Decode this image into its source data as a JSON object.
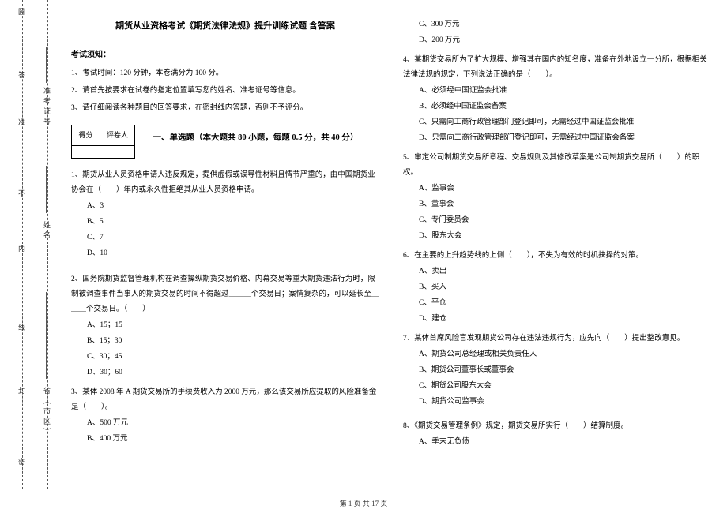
{
  "binding": {
    "outer_labels": [
      "姓名",
      "省（市区）"
    ],
    "inner_labels": [
      "准考证号"
    ],
    "spine_chars": [
      "圆",
      "答",
      "准",
      "不",
      "内",
      "线",
      "封",
      "密"
    ]
  },
  "title": "期货从业资格考试《期货法律法规》提升训练试题 含答案",
  "notice_head": "考试须知：",
  "notices": [
    "1、考试时间：120 分钟，本卷满分为 100 分。",
    "2、请首先按要求在试卷的指定位置填写您的姓名、准考证号等信息。",
    "3、请仔细阅读各种题目的回答要求，在密封线内答题，否则不予评分。"
  ],
  "score_cells": {
    "c1": "得分",
    "c2": "评卷人"
  },
  "section1": "一、单选题（本大题共 80 小题，每题 0.5 分，共 40 分）",
  "q1": {
    "stem": "1、期货从业人员资格申请人违反规定，提供虚假或误导性材料且情节严重的，由中国期货业协会在（　　）年内或永久性拒绝其从业人员资格申请。",
    "opts": [
      "A、3",
      "B、5",
      "C、7",
      "D、10"
    ]
  },
  "q2": {
    "stem": "2、国务院期货监督管理机构在调查操纵期货交易价格、内幕交易等重大期货违法行为时，限制被调查事件当事人的期货交易的时间不得超过＿＿＿个交易日；案情复杂的，可以延长至＿＿＿个交易日。（　　）",
    "opts": [
      "A、15；15",
      "B、15；30",
      "C、30；45",
      "D、30；60"
    ]
  },
  "q3": {
    "stem": "3、某体 2008 年 A 期货交易所的手续费收入为 2000 万元，那么该交易所应提取的风险准备金是（　　）。",
    "opts": [
      "A、500 万元",
      "B、400 万元",
      "C、300 万元",
      "D、200 万元"
    ]
  },
  "q4": {
    "stem": "4、某期货交易所为了扩大规模、增强其在国内的知名度，准备在外地设立一分所，根据相关法律法规的规定，下列说法正确的是（　　）。",
    "opts": [
      "A、必须经中国证监会批准",
      "B、必须经中国证监会备案",
      "C、只需向工商行政管理部门登记即可，无需经过中国证监会批准",
      "D、只需向工商行政管理部门登记即可，无需经过中国证监会备案"
    ]
  },
  "q5": {
    "stem": "5、审定公司制期货交易所章程、交易规则及其修改草案是公司制期货交易所（　　）的职权。",
    "opts": [
      "A、监事会",
      "B、董事会",
      "C、专门委员会",
      "D、股东大会"
    ]
  },
  "q6": {
    "stem": "6、在主要的上升趋势线的上侧（　　），不失为有效的时机抉择的对策。",
    "opts": [
      "A、卖出",
      "B、买入",
      "C、平仓",
      "D、建仓"
    ]
  },
  "q7": {
    "stem": "7、某体首席风险官发现期货公司存在违法违规行为，应先向（　　）提出整改意见。",
    "opts": [
      "A、期货公司总经理或相关负责任人",
      "B、期货公司董事长或董事会",
      "C、期货公司股东大会",
      "D、期货公司监事会"
    ]
  },
  "q8": {
    "stem": "8、《期货交易管理条例》规定，期货交易所实行（　　）结算制度。",
    "opts": [
      "A、季末无负债"
    ]
  },
  "footer": "第 1 页 共 17 页"
}
